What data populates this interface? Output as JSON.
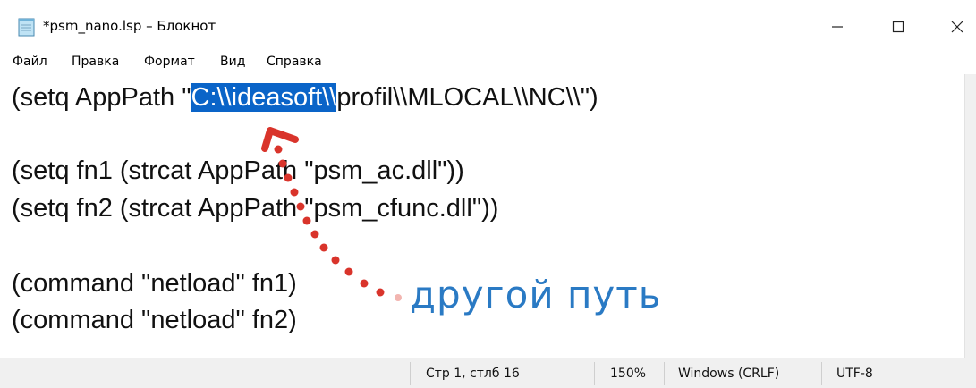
{
  "window": {
    "title": "*psm_nano.lsp – Блокнот"
  },
  "menu": [
    "Файл",
    "Правка",
    "Формат",
    "Вид",
    "Справка"
  ],
  "editor": {
    "line1_prefix": "(setq AppPath \"",
    "line1_selected": "C:\\\\ideasoft\\\\",
    "line1_suffix": "profil\\\\MLOCAL\\\\NC\\\\\")",
    "line3": "(setq fn1 (strcat AppPath \"psm_ac.dll\"))",
    "line4": "(setq fn2 (strcat AppPath \"psm_cfunc.dll\"))",
    "line6": "(command \"netload\" fn1)",
    "line7": "(command \"netload\" fn2)"
  },
  "annotation": {
    "text": "другой путь",
    "color": "#2a7ac4",
    "arrow_color": "#d9342b"
  },
  "statusbar": {
    "position": "Стр 1, стлб 16",
    "zoom": "150%",
    "line_endings": "Windows (CRLF)",
    "encoding": "UTF-8"
  },
  "colors": {
    "selection": "#0a64c8"
  }
}
